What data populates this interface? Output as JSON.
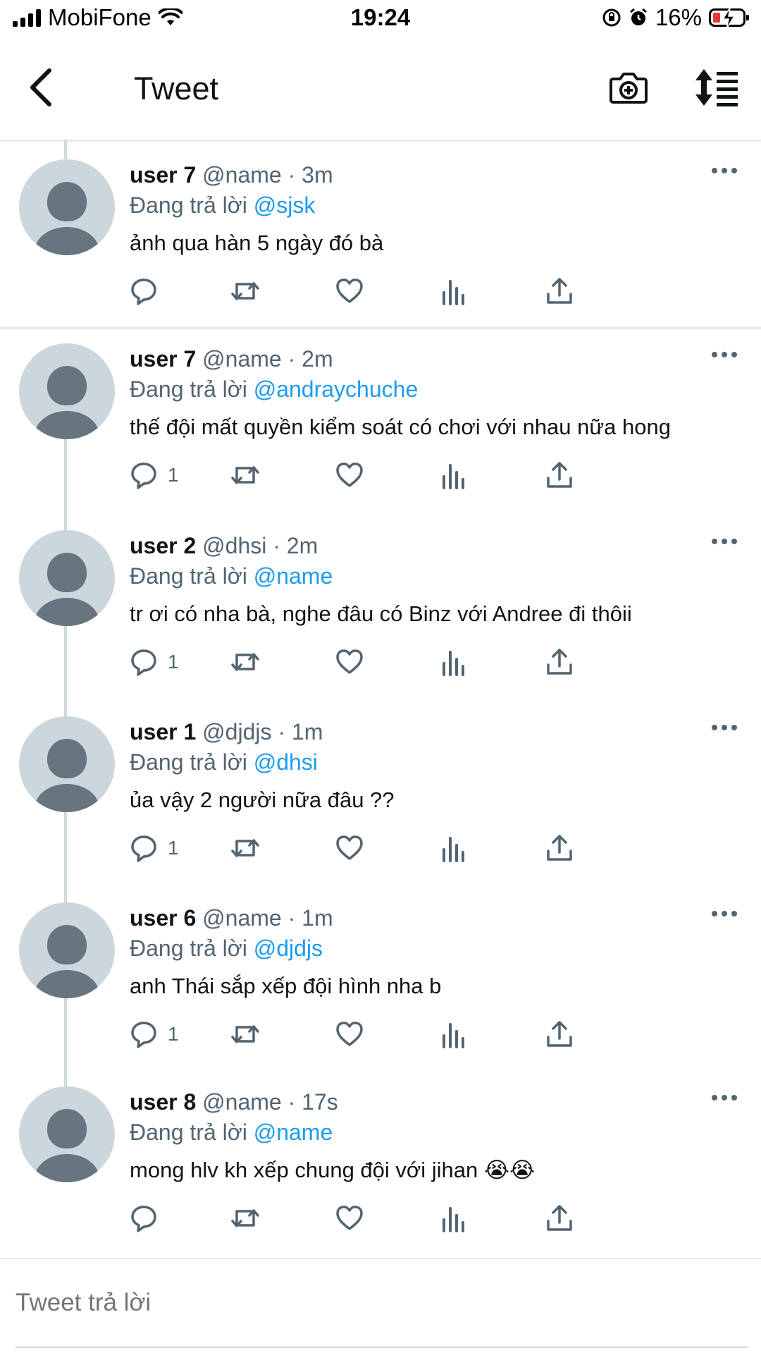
{
  "status_bar": {
    "carrier": "MobiFone",
    "time": "19:24",
    "battery": "16%"
  },
  "header": {
    "title": "Tweet",
    "icons": [
      "back-chevron-icon",
      "camera-plus-icon",
      "sort-icon"
    ]
  },
  "tweets": [
    {
      "name": "user 7",
      "handle": "@name",
      "time": "· 3m",
      "replying_prefix": "Đang trả lời",
      "replying_to": "@sjsk",
      "text": "ảnh qua hàn 5 ngày đó bà",
      "reply_count": ""
    },
    {
      "name": "user 7",
      "handle": "@name",
      "time": "· 2m",
      "replying_prefix": "Đang trả lời",
      "replying_to": "@andraychuche",
      "text": "thế đội mất quyền kiểm soát có chơi với nhau nữa hong",
      "reply_count": "1"
    },
    {
      "name": "user 2",
      "handle": "@dhsi",
      "time": "· 2m",
      "replying_prefix": "Đang trả lời",
      "replying_to": "@name",
      "text": "tr ơi có nha bà, nghe đâu có Binz với Andree đi thôii",
      "reply_count": "1"
    },
    {
      "name": "user 1",
      "handle": "@djdjs",
      "time": "· 1m",
      "replying_prefix": "Đang trả lời",
      "replying_to": "@dhsi",
      "text": "ủa vậy 2 người nữa đâu ??",
      "reply_count": "1"
    },
    {
      "name": "user 6",
      "handle": "@name",
      "time": "· 1m",
      "replying_prefix": "Đang trả lời",
      "replying_to": "@djdjs",
      "text": "anh Thái sắp xếp đội hình nha b",
      "reply_count": "1"
    },
    {
      "name": "user 8",
      "handle": "@name",
      "time": "· 17s",
      "replying_prefix": "Đang trả lời",
      "replying_to": "@name",
      "text": "mong hlv kh xếp chung đội với jihan 😭😭",
      "reply_count": ""
    }
  ],
  "reply_bar": {
    "placeholder": "Tweet trả lời"
  },
  "colors": {
    "accent": "#1d9bf0",
    "secondary_text": "#536471",
    "avatar_bg": "#ccd6dd",
    "avatar_fg": "#66757f",
    "battery_low": "#e53935"
  }
}
